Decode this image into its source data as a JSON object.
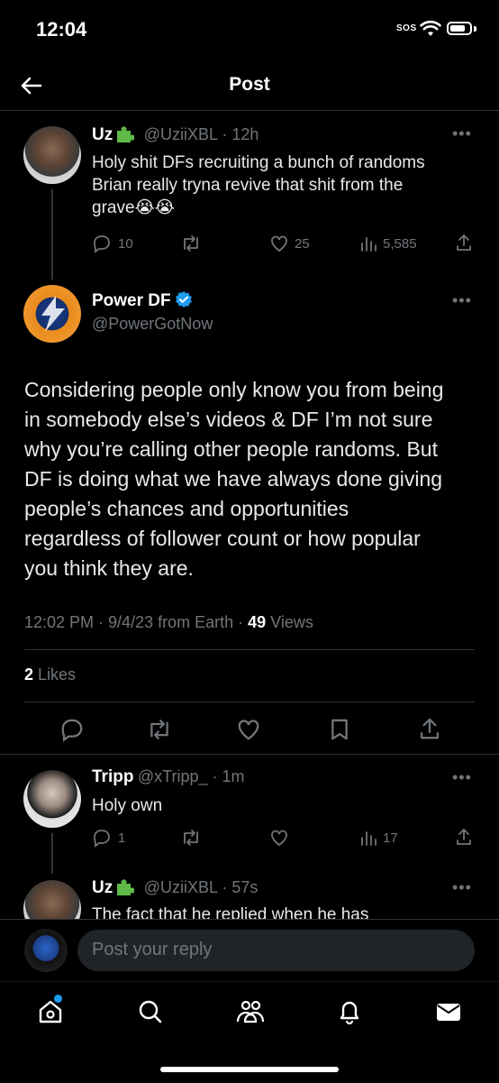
{
  "status_bar": {
    "time": "12:04",
    "sos": "SOS"
  },
  "header": {
    "title": "Post"
  },
  "parent_post": {
    "name": "Uz",
    "handle": "@UziiXBL",
    "time": "12h",
    "text_lines": [
      "Holy shit DFs recruiting a bunch of randoms",
      "Brian really tryna revive that shit from the",
      "grave😭😭"
    ],
    "replies": "10",
    "likes": "25",
    "views": "5,585"
  },
  "main_post": {
    "name": "Power DF",
    "handle": "@PowerGotNow",
    "text_lines": [
      "Considering people only know you from being",
      "in somebody else’s videos & DF I’m not sure",
      "why you’re calling other people randoms. But",
      "DF is doing what we have always done giving",
      "people’s chances and opportunities",
      "regardless of follower count or how popular",
      "you think they are."
    ],
    "timestamp": "12:02 PM · 9/4/23 from Earth · ",
    "views_count": "49",
    "views_label": " Views",
    "likes_count": "2",
    "likes_label": " Likes"
  },
  "reply_1": {
    "name": "Tripp",
    "handle": "@xTripp_",
    "time": "1m",
    "text": "Holy own",
    "replies": "1",
    "views": "17"
  },
  "reply_2": {
    "name": "Uz",
    "handle": "@UziiXBL",
    "time": "57s",
    "text": "The fact that he replied when he has"
  },
  "composer": {
    "placeholder": "Post your reply"
  },
  "colors": {
    "accent": "#1d9bf0",
    "background": "#000000",
    "muted": "#71767b"
  }
}
